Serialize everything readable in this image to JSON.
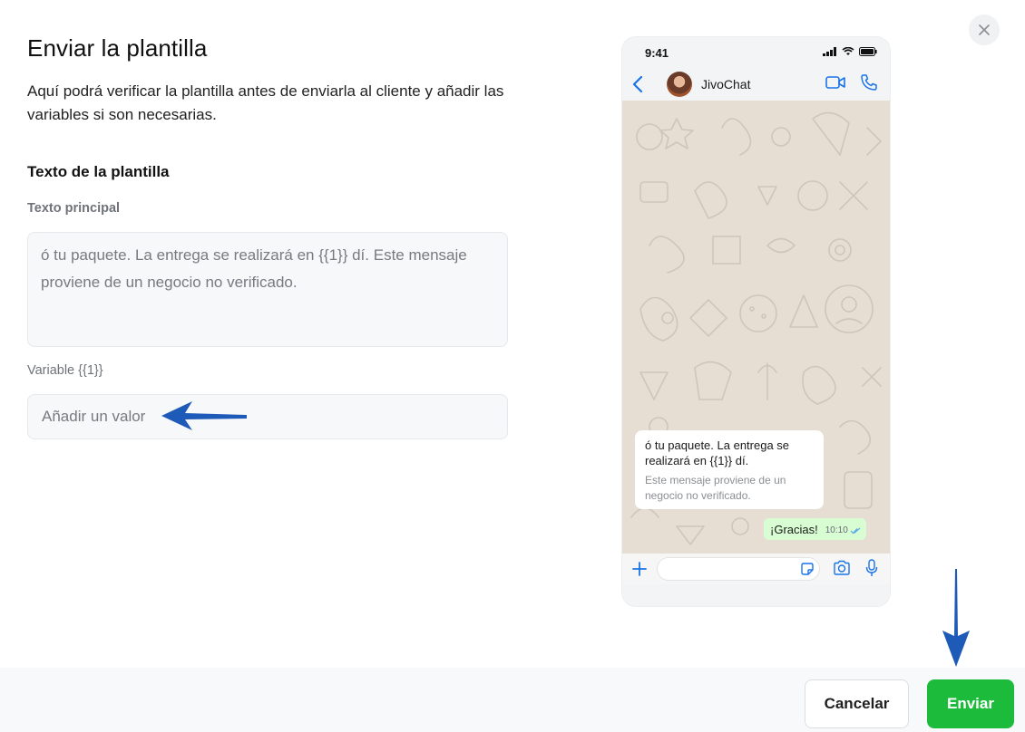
{
  "dialog": {
    "title": "Enviar la plantilla",
    "description": "Aquí podrá verificar la plantilla antes de enviarla al cliente y añadir las variables si son necesarias.",
    "section_title": "Texto de la plantilla",
    "main_text_label": "Texto principal",
    "main_text_value": "ó tu paquete. La entrega se realizará en {{1}} dí. Este mensaje proviene de un negocio no verificado.",
    "variable_label": "Variable {{1}}",
    "variable_placeholder": "Añadir un valor",
    "close_icon": "close-icon"
  },
  "phone_preview": {
    "status_time": "9:41",
    "contact_name": "JivoChat",
    "incoming_text": "ó tu paquete. La entrega se realizará en {{1}} dí.",
    "incoming_footer": "Este mensaje proviene de un negocio no verificado.",
    "outgoing_text": "¡Gracias!",
    "outgoing_time": "10:10",
    "accent_color": "#1a73e8",
    "chat_bg_color": "#e6ded3",
    "outgoing_bubble_color": "#d9fdd3"
  },
  "footer": {
    "cancel_label": "Cancelar",
    "send_label": "Enviar",
    "send_color": "#1dbb3c"
  },
  "annotations": {
    "arrow_color": "#1e5bb8"
  }
}
